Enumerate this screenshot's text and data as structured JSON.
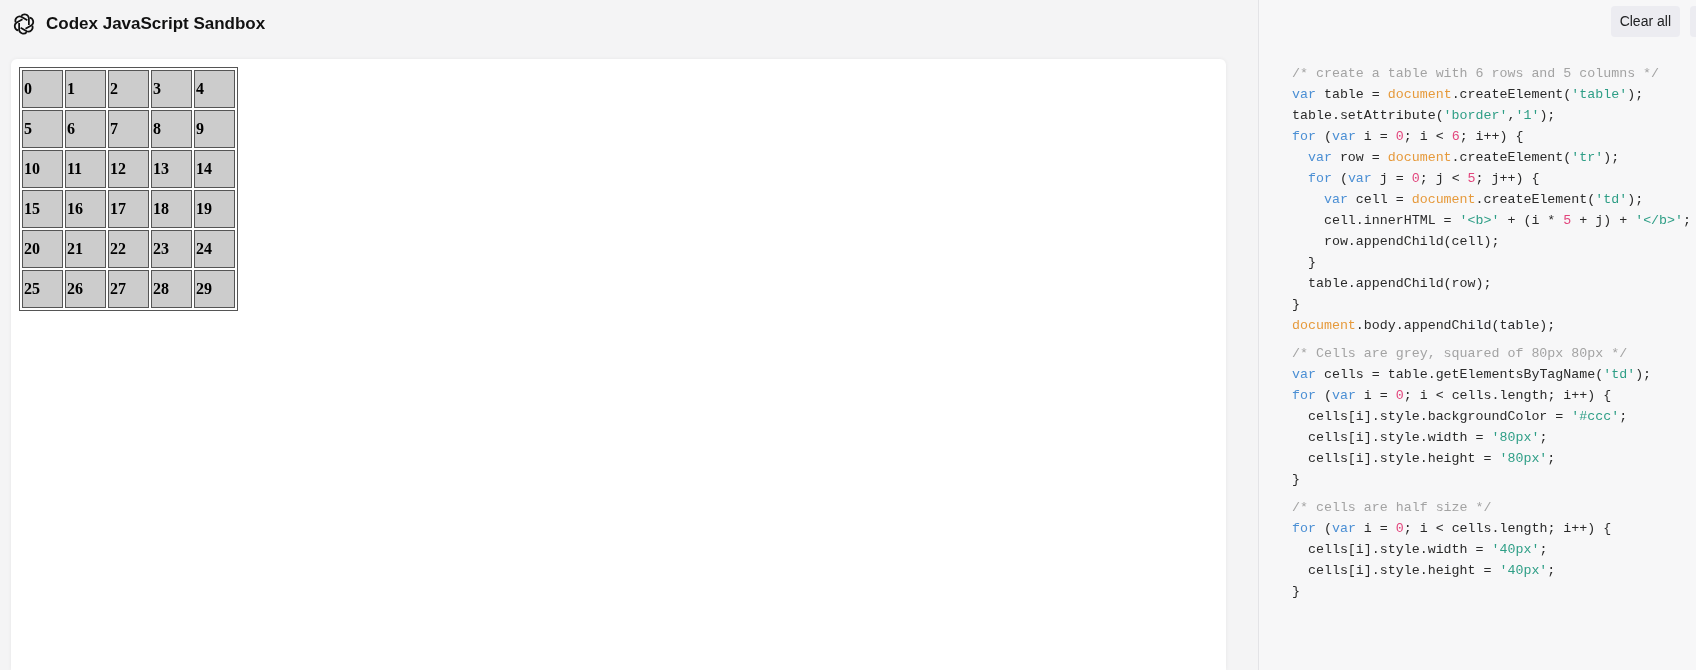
{
  "header": {
    "title": "Codex JavaScript Sandbox"
  },
  "output_table": {
    "rows": [
      [
        "0",
        "1",
        "2",
        "3",
        "4"
      ],
      [
        "5",
        "6",
        "7",
        "8",
        "9"
      ],
      [
        "10",
        "11",
        "12",
        "13",
        "14"
      ],
      [
        "15",
        "16",
        "17",
        "18",
        "19"
      ],
      [
        "20",
        "21",
        "22",
        "23",
        "24"
      ],
      [
        "25",
        "26",
        "27",
        "28",
        "29"
      ]
    ]
  },
  "toolbar": {
    "buttons": [
      {
        "kind": "text",
        "label": "Clear all"
      },
      {
        "kind": "cut"
      }
    ]
  },
  "code_blocks": [
    {
      "lines": [
        [
          {
            "kind": "comment",
            "text": "/* create a table with 6 rows and 5 columns */"
          }
        ],
        [
          {
            "kind": "keyword",
            "text": "var"
          },
          {
            "kind": "plain",
            "text": " table = "
          },
          {
            "kind": "object",
            "text": "document"
          },
          {
            "kind": "plain",
            "text": ".createElement("
          },
          {
            "kind": "string",
            "text": "'table'"
          },
          {
            "kind": "plain",
            "text": ");"
          }
        ],
        [
          {
            "kind": "plain",
            "text": "table.setAttribute("
          },
          {
            "kind": "string",
            "text": "'border'"
          },
          {
            "kind": "plain",
            "text": ","
          },
          {
            "kind": "string",
            "text": "'1'"
          },
          {
            "kind": "plain",
            "text": ");"
          }
        ],
        [
          {
            "kind": "keyword",
            "text": "for"
          },
          {
            "kind": "plain",
            "text": " ("
          },
          {
            "kind": "keyword",
            "text": "var"
          },
          {
            "kind": "plain",
            "text": " i = "
          },
          {
            "kind": "number",
            "text": "0"
          },
          {
            "kind": "plain",
            "text": "; i < "
          },
          {
            "kind": "number",
            "text": "6"
          },
          {
            "kind": "plain",
            "text": "; i++) {"
          }
        ],
        [
          {
            "kind": "keyword",
            "text": "  var"
          },
          {
            "kind": "plain",
            "text": " row = "
          },
          {
            "kind": "object",
            "text": "document"
          },
          {
            "kind": "plain",
            "text": ".createElement("
          },
          {
            "kind": "string",
            "text": "'tr'"
          },
          {
            "kind": "plain",
            "text": ");"
          }
        ],
        [
          {
            "kind": "keyword",
            "text": "  for"
          },
          {
            "kind": "plain",
            "text": " ("
          },
          {
            "kind": "keyword",
            "text": "var"
          },
          {
            "kind": "plain",
            "text": " j = "
          },
          {
            "kind": "number",
            "text": "0"
          },
          {
            "kind": "plain",
            "text": "; j < "
          },
          {
            "kind": "number",
            "text": "5"
          },
          {
            "kind": "plain",
            "text": "; j++) {"
          }
        ],
        [
          {
            "kind": "keyword",
            "text": "    var"
          },
          {
            "kind": "plain",
            "text": " cell = "
          },
          {
            "kind": "object",
            "text": "document"
          },
          {
            "kind": "plain",
            "text": ".createElement("
          },
          {
            "kind": "string",
            "text": "'td'"
          },
          {
            "kind": "plain",
            "text": ");"
          }
        ],
        [
          {
            "kind": "plain",
            "text": "    cell.innerHTML = "
          },
          {
            "kind": "string",
            "text": "'<b>'"
          },
          {
            "kind": "plain",
            "text": " + (i * "
          },
          {
            "kind": "number",
            "text": "5"
          },
          {
            "kind": "plain",
            "text": " + j) + "
          },
          {
            "kind": "string",
            "text": "'</b>'"
          },
          {
            "kind": "plain",
            "text": ";"
          }
        ],
        [
          {
            "kind": "plain",
            "text": "    row.appendChild(cell);"
          }
        ],
        [
          {
            "kind": "plain",
            "text": "  }"
          }
        ],
        [
          {
            "kind": "plain",
            "text": "  table.appendChild(row);"
          }
        ],
        [
          {
            "kind": "plain",
            "text": "}"
          }
        ],
        [
          {
            "kind": "object",
            "text": "document"
          },
          {
            "kind": "plain",
            "text": ".body.appendChild(table);"
          }
        ]
      ]
    },
    {
      "lines": [
        [
          {
            "kind": "comment",
            "text": "/* Cells are grey, squared of 80px 80px */"
          }
        ],
        [
          {
            "kind": "keyword",
            "text": "var"
          },
          {
            "kind": "plain",
            "text": " cells = table.getElementsByTagName("
          },
          {
            "kind": "string",
            "text": "'td'"
          },
          {
            "kind": "plain",
            "text": ");"
          }
        ],
        [
          {
            "kind": "keyword",
            "text": "for"
          },
          {
            "kind": "plain",
            "text": " ("
          },
          {
            "kind": "keyword",
            "text": "var"
          },
          {
            "kind": "plain",
            "text": " i = "
          },
          {
            "kind": "number",
            "text": "0"
          },
          {
            "kind": "plain",
            "text": "; i < cells.length; i++) {"
          }
        ],
        [
          {
            "kind": "plain",
            "text": "  cells[i].style.backgroundColor = "
          },
          {
            "kind": "string",
            "text": "'#ccc'"
          },
          {
            "kind": "plain",
            "text": ";"
          }
        ],
        [
          {
            "kind": "plain",
            "text": "  cells[i].style.width = "
          },
          {
            "kind": "string",
            "text": "'80px'"
          },
          {
            "kind": "plain",
            "text": ";"
          }
        ],
        [
          {
            "kind": "plain",
            "text": "  cells[i].style.height = "
          },
          {
            "kind": "string",
            "text": "'80px'"
          },
          {
            "kind": "plain",
            "text": ";"
          }
        ],
        [
          {
            "kind": "plain",
            "text": "}"
          }
        ]
      ]
    },
    {
      "lines": [
        [
          {
            "kind": "comment",
            "text": "/* cells are half size */"
          }
        ],
        [
          {
            "kind": "keyword",
            "text": "for"
          },
          {
            "kind": "plain",
            "text": " ("
          },
          {
            "kind": "keyword",
            "text": "var"
          },
          {
            "kind": "plain",
            "text": " i = "
          },
          {
            "kind": "number",
            "text": "0"
          },
          {
            "kind": "plain",
            "text": "; i < cells.length; i++) {"
          }
        ],
        [
          {
            "kind": "plain",
            "text": "  cells[i].style.width = "
          },
          {
            "kind": "string",
            "text": "'40px'"
          },
          {
            "kind": "plain",
            "text": ";"
          }
        ],
        [
          {
            "kind": "plain",
            "text": "  cells[i].style.height = "
          },
          {
            "kind": "string",
            "text": "'40px'"
          },
          {
            "kind": "plain",
            "text": ";"
          }
        ],
        [
          {
            "kind": "plain",
            "text": "}"
          }
        ]
      ]
    }
  ]
}
